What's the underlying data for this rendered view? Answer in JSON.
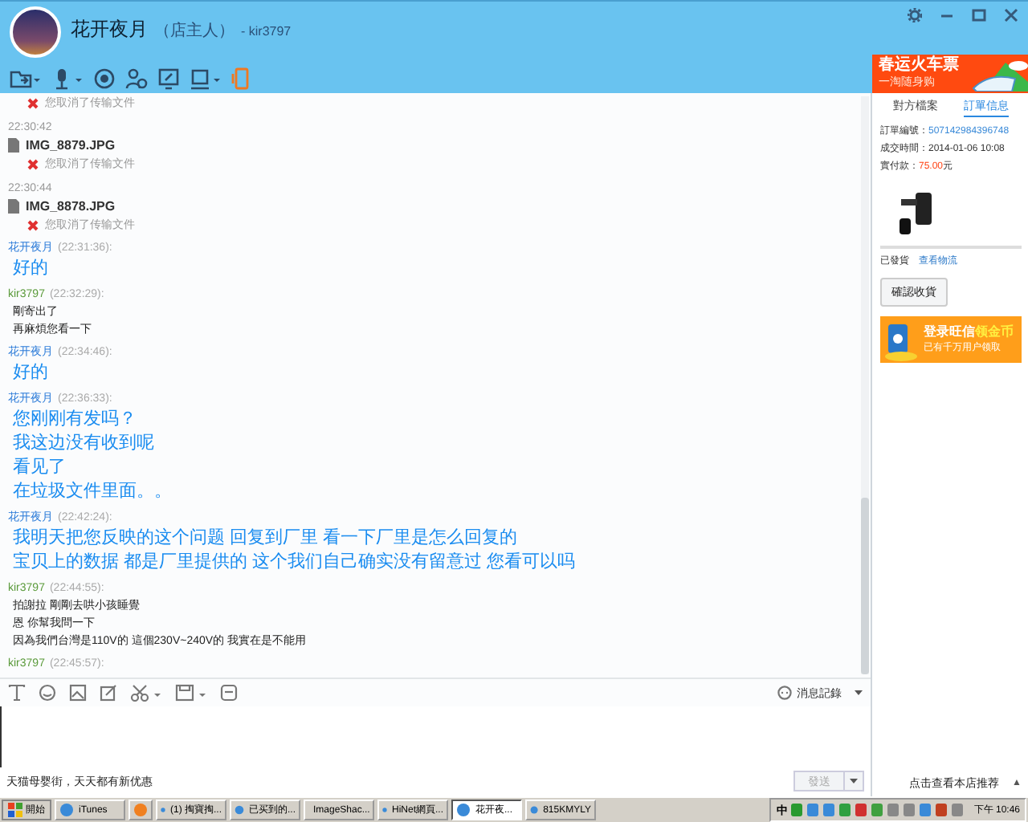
{
  "header": {
    "name": "花开夜月",
    "role": "（店主人）",
    "account": "- kir3797"
  },
  "messages": [
    {
      "kind": "file",
      "status": "您取消了传输文件"
    },
    {
      "kind": "file",
      "time": "22:30:42",
      "name": "IMG_8879.JPG",
      "status": "您取消了传输文件"
    },
    {
      "kind": "file",
      "time": "22:30:44",
      "name": "IMG_8878.JPG",
      "status": "您取消了传输文件"
    },
    {
      "kind": "seller",
      "sender": "花开夜月",
      "time": "(22:31:36):",
      "lines": [
        "好的"
      ]
    },
    {
      "kind": "buyer",
      "sender": "kir3797",
      "time": "(22:32:29):",
      "lines": [
        "剛寄出了",
        "再麻煩您看一下"
      ]
    },
    {
      "kind": "seller",
      "sender": "花开夜月",
      "time": "(22:34:46):",
      "lines": [
        "好的"
      ]
    },
    {
      "kind": "seller",
      "sender": "花开夜月",
      "time": "(22:36:33):",
      "lines": [
        "您刚刚有发吗？",
        "我这边没有收到呢",
        "看见了",
        "在垃圾文件里面。。"
      ]
    },
    {
      "kind": "seller",
      "sender": "花开夜月",
      "time": "(22:42:24):",
      "lines": [
        "我明天把您反映的这个问题 回复到厂里 看一下厂里是怎么回复的",
        "宝贝上的数据 都是厂里提供的 这个我们自己确实没有留意过 您看可以吗"
      ]
    },
    {
      "kind": "buyer",
      "sender": "kir3797",
      "time": "(22:44:55):",
      "lines": [
        "拍謝拉 剛剛去哄小孩睡覺",
        "恩 你幫我問一下",
        "因為我們台灣是110V的 這個230V~240V的 我實在是不能用"
      ]
    },
    {
      "kind": "buyer",
      "sender": "kir3797",
      "time": "(22:45:57):"
    }
  ],
  "input_toolbar": {
    "history": "消息記錄"
  },
  "footer": {
    "promo": "天猫母婴街，天天都有新优惠",
    "send": "發送",
    "send_disabled": true,
    "recommend": "点击查看本店推荐",
    "arrow": "▲"
  },
  "ad_top": {
    "title": "春运火车票",
    "subtitle": "一淘随身购"
  },
  "side_tabs": [
    {
      "label": "對方檔案",
      "selected": false
    },
    {
      "label": "訂單信息",
      "selected": true
    }
  ],
  "order": {
    "number_label": "訂單編號：",
    "number": "507142984396748",
    "time_label": "成交時間：",
    "time": "2014-01-06 10:08",
    "paid_label": "實付款：",
    "paid": "75.00",
    "currency": "元",
    "shipped": "已發貨",
    "logistics": "查看物流",
    "confirm": "確認收貨"
  },
  "ad_side": {
    "title": "登录旺信",
    "highlight": "领金币",
    "subtitle": "已有千万用户领取"
  },
  "taskbar": {
    "start": "開始",
    "clock": "下午 10:46",
    "ime": "中",
    "tasks": [
      {
        "label": "iTunes",
        "selected": false
      },
      {
        "selected": false
      },
      {
        "label": "(1) 掏寶掏...",
        "selected": false
      },
      {
        "label": "已买到的...",
        "selected": false
      },
      {
        "label": "ImageShac...",
        "selected": false
      },
      {
        "label": "HiNet網頁...",
        "selected": false
      },
      {
        "label": "花开夜...",
        "selected": true
      },
      {
        "label": "815KMYLY",
        "selected": false
      }
    ]
  }
}
